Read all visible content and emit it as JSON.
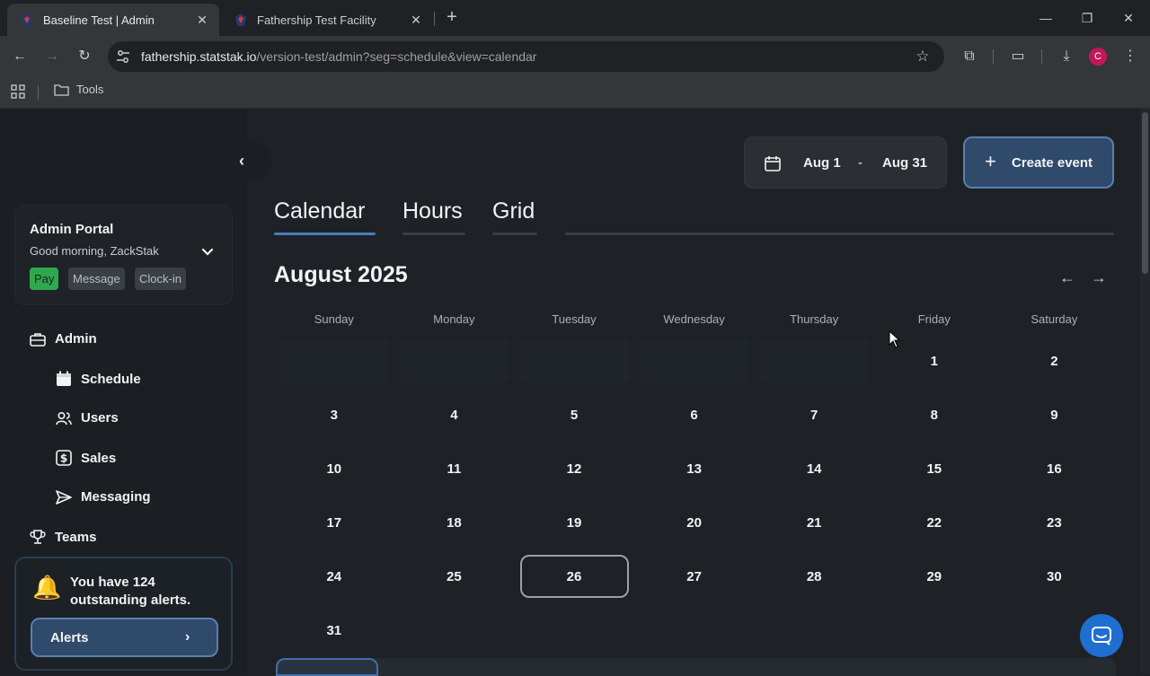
{
  "browser": {
    "tabs": [
      {
        "title": "Baseline Test | Admin",
        "active": true
      },
      {
        "title": "Fathership Test Facility",
        "active": false
      }
    ],
    "url_host": "fathership.statstak.io",
    "url_path": "/version-test/admin?seg=schedule&view=calendar",
    "bookmark_folder": "Tools",
    "profile_initial": "C"
  },
  "sidebar": {
    "portal_title": "Admin Portal",
    "greeting": "Good morning, ZackStak",
    "pills": {
      "pay": "Pay",
      "message": "Message",
      "clockin": "Clock-in"
    },
    "nav": {
      "admin": "Admin",
      "schedule": "Schedule",
      "users": "Users",
      "sales": "Sales",
      "messaging": "Messaging",
      "teams": "Teams"
    },
    "alerts_text": "You have 124 outstanding alerts.",
    "alerts_button": "Alerts"
  },
  "header": {
    "date_from": "Aug 1",
    "date_sep": "-",
    "date_to": "Aug 31",
    "create_label": "Create event"
  },
  "views": {
    "calendar": "Calendar",
    "hours": "Hours",
    "grid": "Grid"
  },
  "calendar": {
    "month_title": "August 2025",
    "weekdays": [
      "Sunday",
      "Monday",
      "Tuesday",
      "Wednesday",
      "Thursday",
      "Friday",
      "Saturday"
    ],
    "today": "26",
    "weeks": [
      [
        "",
        "",
        "",
        "",
        "",
        "1",
        "2"
      ],
      [
        "3",
        "4",
        "5",
        "6",
        "7",
        "8",
        "9"
      ],
      [
        "10",
        "11",
        "12",
        "13",
        "14",
        "15",
        "16"
      ],
      [
        "17",
        "18",
        "19",
        "20",
        "21",
        "22",
        "23"
      ],
      [
        "24",
        "25",
        "26",
        "27",
        "28",
        "29",
        "30"
      ],
      [
        "31",
        "",
        "",
        "",
        "",
        "",
        ""
      ]
    ]
  },
  "colors": {
    "accent": "#5a7fae",
    "button_bg": "#2f4a6b",
    "pay_green": "#2fa84f"
  }
}
